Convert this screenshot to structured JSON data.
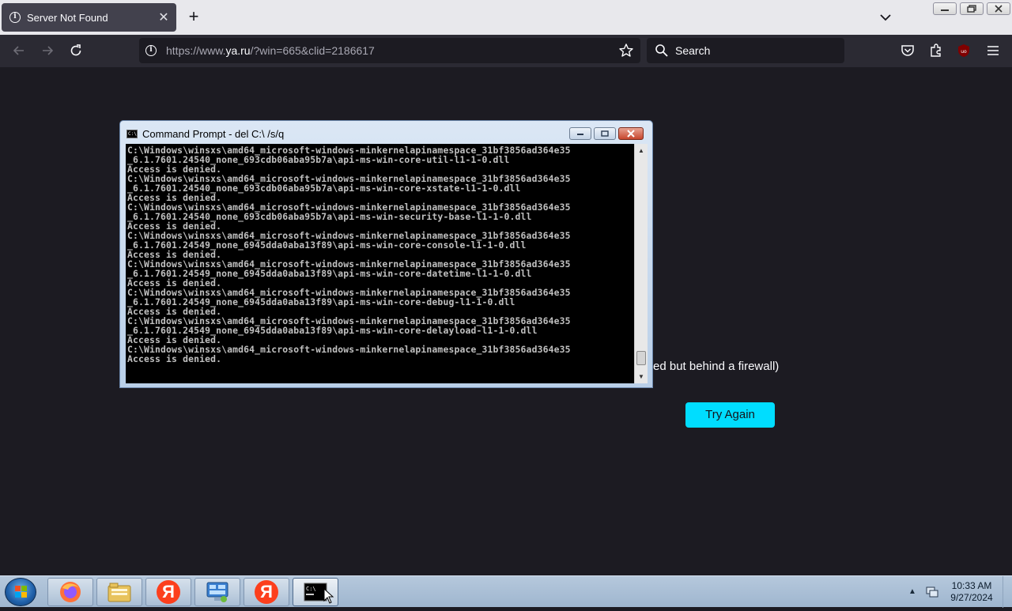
{
  "browser": {
    "tab": {
      "title": "Server Not Found",
      "icon": "info-icon"
    },
    "url": {
      "prefix": "https://www.",
      "domain": "ya.ru",
      "suffix": "/?win=665&clid=2186617"
    },
    "search": {
      "placeholder": "Search"
    }
  },
  "page": {
    "firewall_text": "ed but behind a firewall)",
    "try_again_label": "Try Again",
    "accent_color": "#00ddff"
  },
  "cmd": {
    "title": "Command Prompt - del  C:\\ /s/q",
    "lines": [
      "C:\\Windows\\winsxs\\amd64_microsoft-windows-minkernelapinamespace_31bf3856ad364e35",
      "_6.1.7601.24540_none_693cdb06aba95b7a\\api-ms-win-core-util-l1-1-0.dll",
      "Access is denied.",
      "C:\\Windows\\winsxs\\amd64_microsoft-windows-minkernelapinamespace_31bf3856ad364e35",
      "_6.1.7601.24540_none_693cdb06aba95b7a\\api-ms-win-core-xstate-l1-1-0.dll",
      "Access is denied.",
      "C:\\Windows\\winsxs\\amd64_microsoft-windows-minkernelapinamespace_31bf3856ad364e35",
      "_6.1.7601.24540_none_693cdb06aba95b7a\\api-ms-win-security-base-l1-1-0.dll",
      "Access is denied.",
      "C:\\Windows\\winsxs\\amd64_microsoft-windows-minkernelapinamespace_31bf3856ad364e35",
      "_6.1.7601.24549_none_6945dda0aba13f89\\api-ms-win-core-console-l1-1-0.dll",
      "Access is denied.",
      "C:\\Windows\\winsxs\\amd64_microsoft-windows-minkernelapinamespace_31bf3856ad364e35",
      "_6.1.7601.24549_none_6945dda0aba13f89\\api-ms-win-core-datetime-l1-1-0.dll",
      "Access is denied.",
      "C:\\Windows\\winsxs\\amd64_microsoft-windows-minkernelapinamespace_31bf3856ad364e35",
      "_6.1.7601.24549_none_6945dda0aba13f89\\api-ms-win-core-debug-l1-1-0.dll",
      "Access is denied.",
      "C:\\Windows\\winsxs\\amd64_microsoft-windows-minkernelapinamespace_31bf3856ad364e35",
      "_6.1.7601.24549_none_6945dda0aba13f89\\api-ms-win-core-delayload-l1-1-0.dll",
      "Access is denied.",
      "C:\\Windows\\winsxs\\amd64_microsoft-windows-minkernelapinamespace_31bf3856ad364e35",
      "Access is denied."
    ]
  },
  "taskbar": {
    "apps": [
      "firefox-icon",
      "file-explorer-icon",
      "yandex-icon",
      "control-panel-icon",
      "yandex-icon",
      "command-prompt-icon"
    ],
    "yandex_letter": "Я",
    "time": "10:33 AM",
    "date": "9/27/2024"
  }
}
